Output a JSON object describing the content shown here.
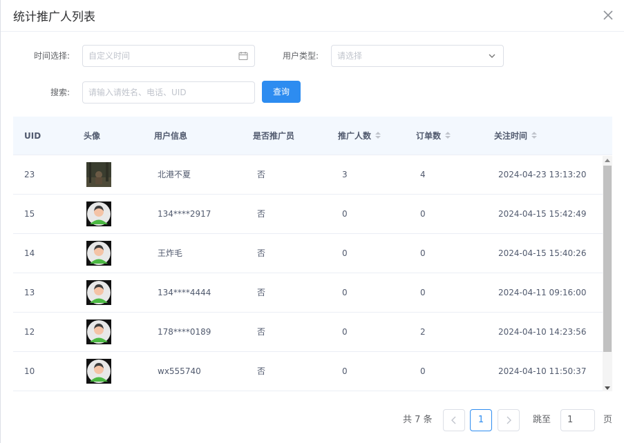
{
  "dialog": {
    "title": "统计推广人列表"
  },
  "filters": {
    "time_label": "时间选择:",
    "time_placeholder": "自定义时间",
    "user_type_label": "用户类型:",
    "user_type_placeholder": "请选择",
    "search_label": "搜索:",
    "search_placeholder": "请输入请姓名、电话、UID",
    "query_button": "查询"
  },
  "table": {
    "columns": [
      "UID",
      "头像",
      "用户信息",
      "是否推广员",
      "推广人数",
      "订单数",
      "关注时间"
    ],
    "rows": [
      {
        "uid": "23",
        "avatar": "photo-avatar",
        "info": "北港不夏",
        "is_promoter": "否",
        "promote_count": "3",
        "order_count": "4",
        "follow_time": "2024-04-23 13:13:20"
      },
      {
        "uid": "15",
        "avatar": "default-avatar",
        "info": "134****2917",
        "is_promoter": "否",
        "promote_count": "0",
        "order_count": "0",
        "follow_time": "2024-04-15 15:42:49"
      },
      {
        "uid": "14",
        "avatar": "default-avatar",
        "info": "王炸毛",
        "is_promoter": "否",
        "promote_count": "0",
        "order_count": "0",
        "follow_time": "2024-04-15 15:40:26"
      },
      {
        "uid": "13",
        "avatar": "default-avatar",
        "info": "134****4444",
        "is_promoter": "否",
        "promote_count": "0",
        "order_count": "0",
        "follow_time": "2024-04-11 09:16:00"
      },
      {
        "uid": "12",
        "avatar": "default-avatar",
        "info": "178****0189",
        "is_promoter": "否",
        "promote_count": "0",
        "order_count": "2",
        "follow_time": "2024-04-10 14:23:56"
      },
      {
        "uid": "10",
        "avatar": "default-avatar",
        "info": "wx555740",
        "is_promoter": "否",
        "promote_count": "0",
        "order_count": "0",
        "follow_time": "2024-04-10 11:50:37"
      }
    ]
  },
  "pagination": {
    "total": "共 7 条",
    "current_page": "1",
    "jump_label": "跳至",
    "jump_value": "1",
    "page_unit": "页"
  },
  "colors": {
    "primary": "#2d8cf0",
    "header_bg": "#f3f8fe"
  }
}
